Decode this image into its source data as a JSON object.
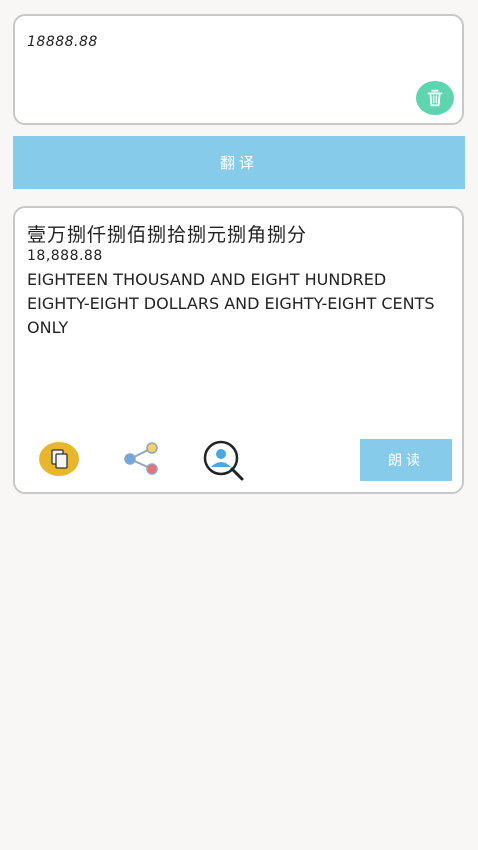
{
  "input": {
    "value": "18888.88"
  },
  "icons": {
    "trash": "trash-icon",
    "copy": "copy-icon",
    "share": "share-icon",
    "search_user": "search-user-icon"
  },
  "translate_button": {
    "label": "翻译"
  },
  "result": {
    "chinese_uppercase": "壹万捌仟捌佰捌拾捌元捌角捌分",
    "formatted_number": "18,888.88",
    "english_words": "EIGHTEEN THOUSAND AND EIGHT HUNDRED EIGHTY-EIGHT DOLLARS AND EIGHTY-EIGHT CENTS ONLY"
  },
  "read_button": {
    "label": "朗读"
  },
  "colors": {
    "accent_blue": "#87cbea",
    "trash_green": "#5dd6b0",
    "copy_yellow": "#e8b62d",
    "background": "#f8f7f6"
  }
}
